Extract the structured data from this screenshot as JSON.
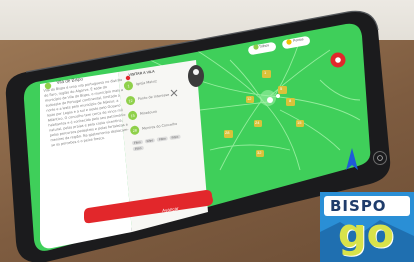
{
  "colors": {
    "map_green": "#3fcf5a",
    "road": "#9df0a4",
    "accent_green": "#8fd04a",
    "red": "#e2272b",
    "phone": "#1b1b1d",
    "table": "#8e6a4b",
    "wall": "#e9e6df",
    "logo_blue": "#2a8fd6",
    "logo_yellow": "#d8e24a"
  },
  "panel": {
    "title": "Vila de Bispo",
    "text": "Vila do Bispo é uma vila portuguesa no distrito de Faro, região do Algarve. É sede do município de Vila do Bispo, o município mais a sudoeste de Portugal continental, limitado a norte e a leste pelo município de Aljezur, a leste por Lagos e a sul e oeste pelo Oceano Atlântico. O concelho tem cerca de cinco mil habitantes e é conhecido pelo seu património natural, pelas praias e pela costa vicentina, pelos percursos pedestres e pelas fortalezas e menires da região. Na gastronomia destacam-se os percebes e o peixe fresco.",
    "button_label": "Avançar"
  },
  "side_panel": {
    "header": "VISITAR A VILA",
    "items": [
      {
        "num": "1",
        "text": "Igreja Matriz"
      },
      {
        "num": "12",
        "text": "Ponto de Interesse"
      },
      {
        "num": "15",
        "text": "Miradouro"
      },
      {
        "num": "28",
        "text": "Menires do Concelho"
      }
    ],
    "chips": [
      "Filtro",
      "Filtro",
      "Filtro",
      "Filtro",
      "Filtro"
    ]
  },
  "map": {
    "top_pill_left": "Trilhos",
    "top_pill_right": "Pontos",
    "markers": [
      "1",
      "5",
      "8",
      "12",
      "15",
      "24",
      "28",
      "32"
    ]
  },
  "logo": {
    "top_text": "BISPO",
    "bottom_text": "go"
  }
}
